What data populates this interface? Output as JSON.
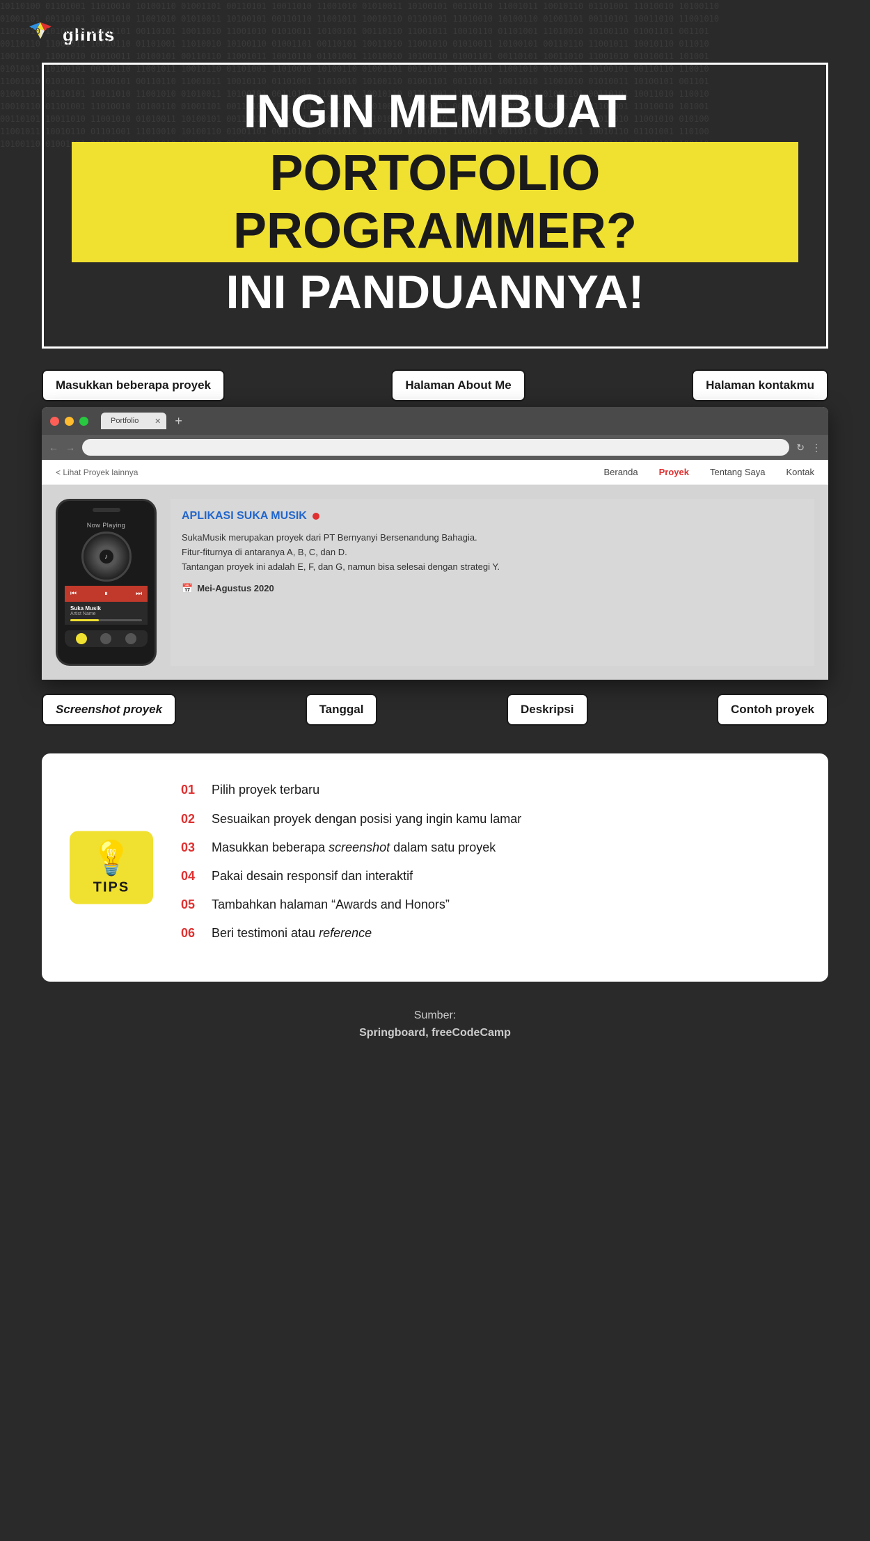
{
  "logo": {
    "text": "glints"
  },
  "hero": {
    "line1": "INGIN MEMBUAT",
    "line2": "PORTOFOLIO PROGRAMMER?",
    "line3": "INI PANDUANNYA!"
  },
  "callouts": {
    "top_left": "Masukkan beberapa proyek",
    "top_center": "Halaman About Me",
    "top_right": "Halaman kontakmu"
  },
  "browser": {
    "tab_label": "",
    "url": ""
  },
  "site_nav": {
    "back": "< Lihat Proyek lainnya",
    "links": [
      "Beranda",
      "Proyek",
      "Tentang Saya",
      "Kontak"
    ]
  },
  "phone": {
    "now_playing": "Now Playing",
    "song_title": "Suka Musik",
    "song_sub": "Artist Name"
  },
  "project": {
    "title": "APLIKASI SUKA MUSIK",
    "desc1": "SukaMusik merupakan proyek dari PT Bernyanyi Bersenandung Bahagia.",
    "desc2": "Fitur-fiturnya di antaranya A, B, C, dan D.",
    "desc3": "Tantangan proyek ini adalah E, F, dan G, namun bisa selesai dengan strategi Y.",
    "date": "Mei-Agustus 2020"
  },
  "bottom_labels": {
    "label1": "Screenshot proyek",
    "label2": "Tanggal",
    "label3": "Deskripsi",
    "label4": "Contoh proyek"
  },
  "tips": {
    "badge": "TIPS",
    "items": [
      {
        "num": "01",
        "text": "Pilih proyek terbaru"
      },
      {
        "num": "02",
        "text": "Sesuaikan proyek dengan posisi yang ingin kamu lamar"
      },
      {
        "num": "03",
        "text": "Masukkan beberapa screenshot dalam satu proyek"
      },
      {
        "num": "04",
        "text": "Pakai desain responsif dan interaktif"
      },
      {
        "num": "05",
        "text": "Tambahkan halaman “Awards and Honors”"
      },
      {
        "num": "06",
        "text": "Beri testimoni atau reference"
      }
    ]
  },
  "footer": {
    "label": "Sumber:",
    "sources": "Springboard, freeCodeCamp"
  }
}
